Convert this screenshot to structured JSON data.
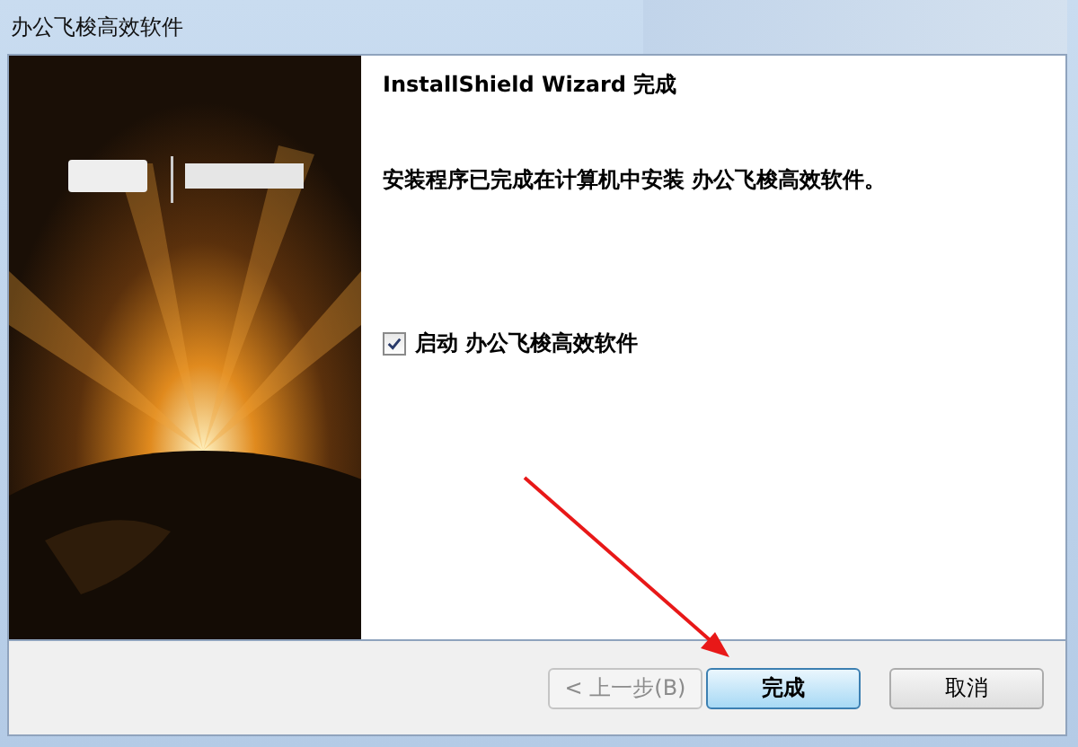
{
  "window": {
    "title": "办公飞梭高效软件"
  },
  "heading": "InstallShield Wizard 完成",
  "message": "安装程序已完成在计算机中安装 办公飞梭高效软件。",
  "launch_option": {
    "label": "启动 办公飞梭高效软件",
    "checked": true
  },
  "buttons": [
    {
      "label": "< 上一步(B)",
      "disabled": true,
      "default": false
    },
    {
      "label": "完成",
      "disabled": false,
      "default": true
    },
    {
      "label": "取消",
      "disabled": false,
      "default": false
    }
  ]
}
